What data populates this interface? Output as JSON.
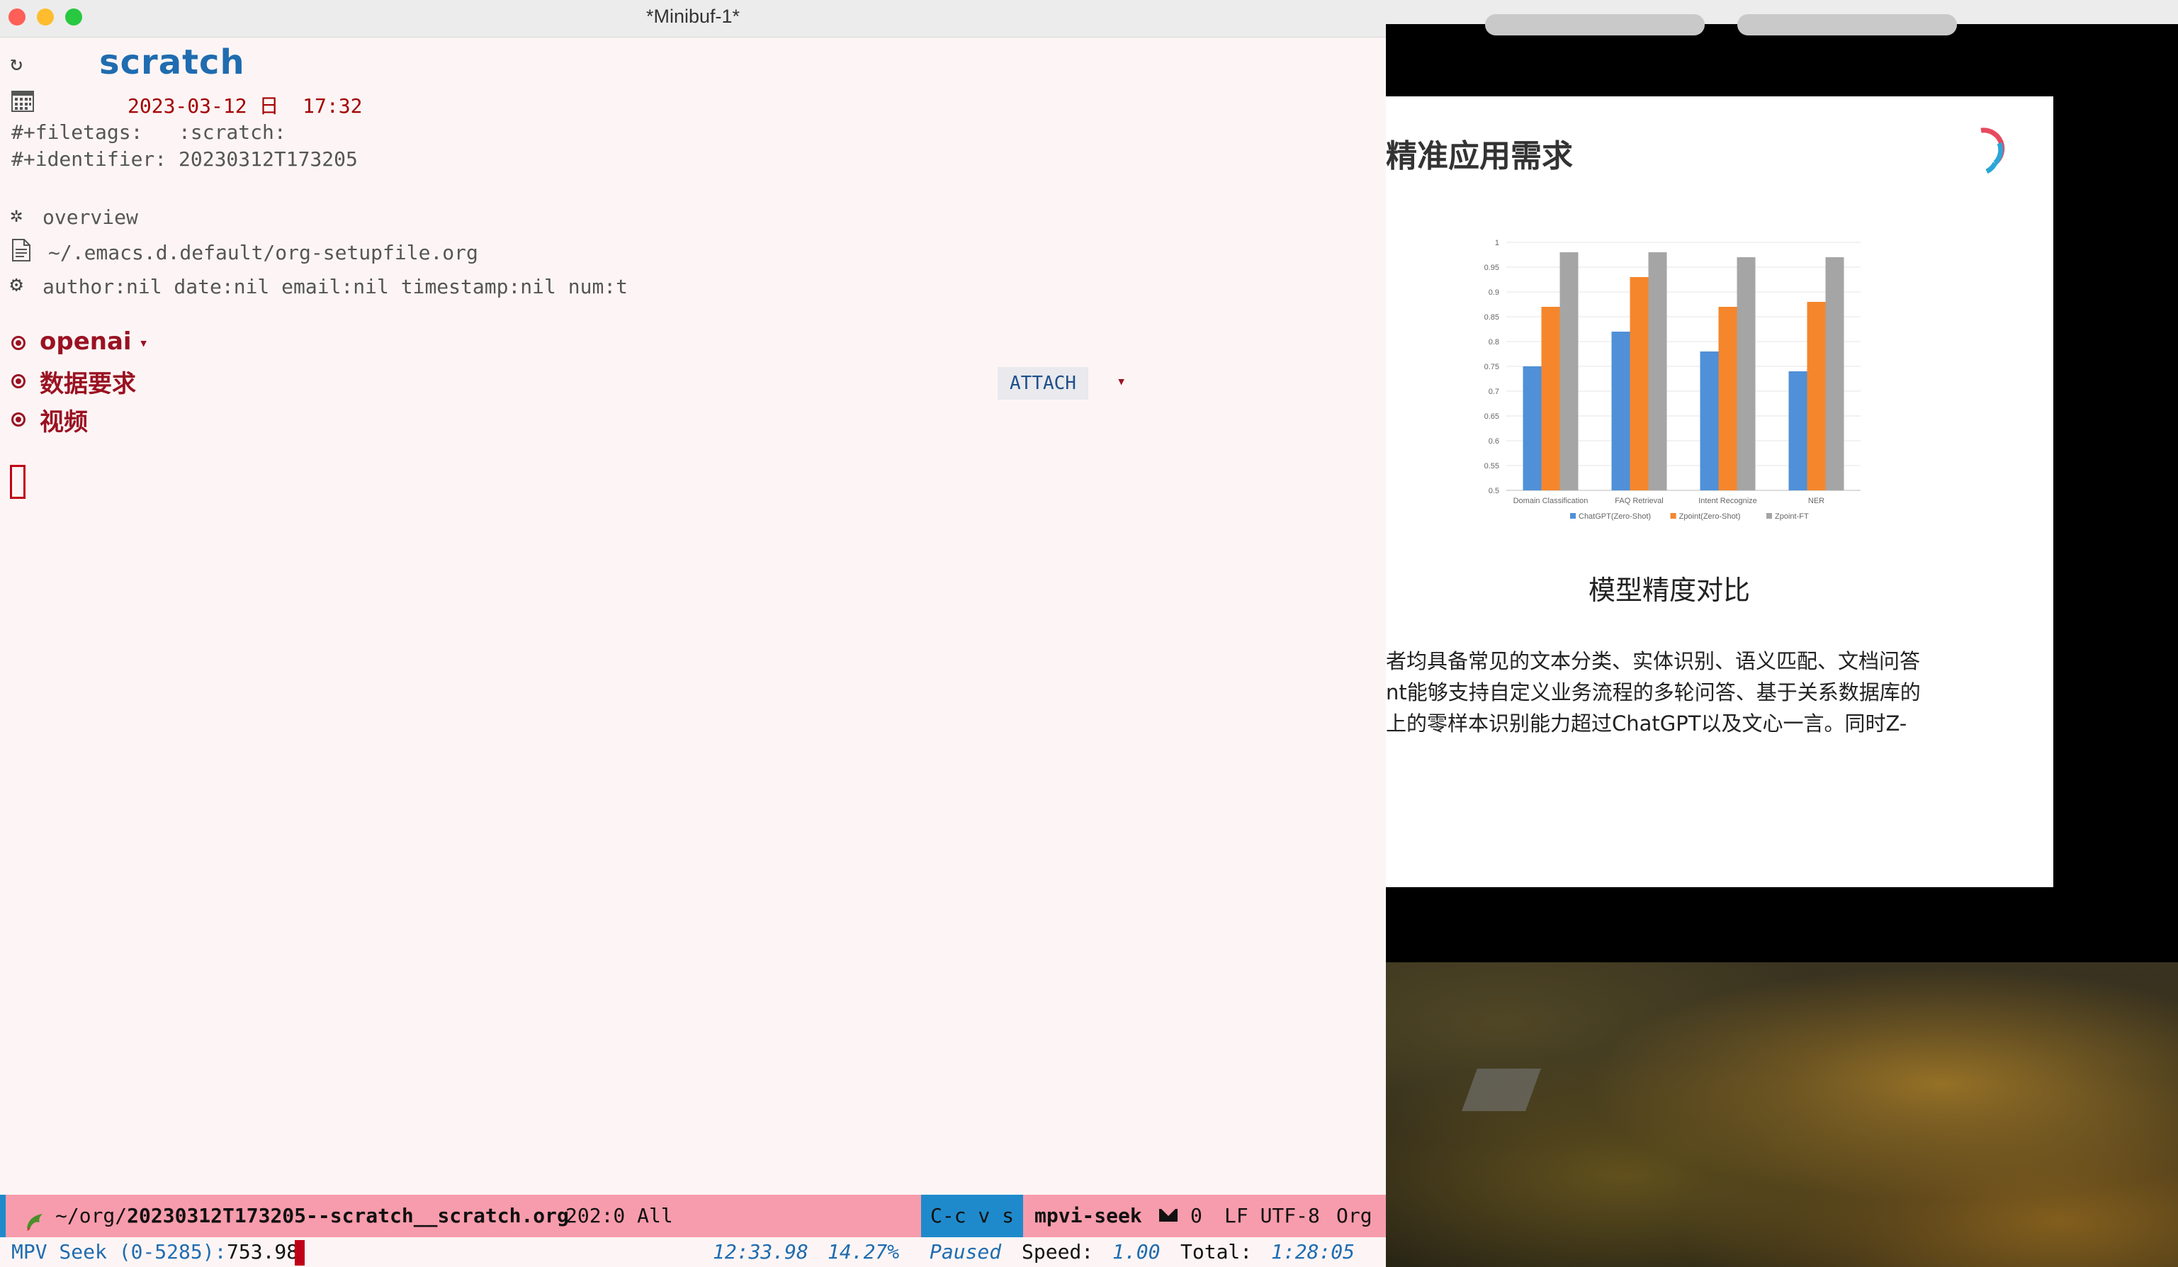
{
  "window": {
    "title": "*Minibuf-1*"
  },
  "buffer": {
    "title": "scratch",
    "date": "2023-03-12",
    "weekday": "日",
    "time": "17:32",
    "filetags_line": "#+filetags:   :scratch:",
    "identifier_line": "#+identifier: 20230312T173205",
    "overview_line": "overview",
    "setupfile_line": "~/.emacs.d.default/org-setupfile.org",
    "options_line": "author:nil date:nil email:nil timestamp:nil num:t",
    "headings": [
      {
        "text": "openai",
        "folded_marker": "▾"
      },
      {
        "text": "数据要求",
        "tag_button": "ATTACH",
        "folded_marker": "▾"
      },
      {
        "text": "视频"
      }
    ]
  },
  "modeline": {
    "path_prefix": "~/org/",
    "filename": "20230312T173205--scratch__scratch.org",
    "position": "202:0 All",
    "keys": "C-c v s",
    "mode": "mpvi-seek",
    "mail_count": "0",
    "encoding": "LF UTF-8",
    "major_mode": "Org"
  },
  "minibuffer": {
    "prompt": "MPV Seek (0-5285): ",
    "value": "753.98",
    "current_time": "12:33.98",
    "percent": "14.27%",
    "state": "Paused",
    "speed_label": "Speed:",
    "speed": "1.00",
    "total_label": "Total:",
    "total": "1:28:05"
  },
  "slide": {
    "title": "精准应用需求",
    "caption": "模型精度对比",
    "lines": [
      "者均具备常见的文本分类、实体识别、语义匹配、文档问答",
      "nt能够支持自定义业务流程的多轮问答、基于关系数据库的",
      "上的零样本识别能力超过ChatGPT以及文心一言。同时Z-"
    ]
  },
  "chart_data": {
    "type": "bar",
    "categories": [
      "Domain Classification",
      "FAQ Retrieval",
      "Intent Recognize",
      "NER"
    ],
    "series": [
      {
        "name": "ChatGPT(Zero-Shot)",
        "values": [
          0.75,
          0.82,
          0.78,
          0.74
        ],
        "color": "#4f90d8"
      },
      {
        "name": "Zpoint(Zero-Shot)",
        "values": [
          0.87,
          0.93,
          0.87,
          0.88
        ],
        "color": "#f5862c"
      },
      {
        "name": "Zpoint-FT",
        "values": [
          0.98,
          0.98,
          0.97,
          0.97
        ],
        "color": "#a5a5a5"
      }
    ],
    "yticks": [
      "0.5",
      "0.55",
      "0.6",
      "0.65",
      "0.7",
      "0.75",
      "0.8",
      "0.85",
      "0.9",
      "0.95",
      "1"
    ],
    "ylim": [
      0.5,
      1
    ],
    "grid": true,
    "legend": "bottom"
  },
  "colors": {
    "heading_blue": "#1f6cb0",
    "headline_red": "#9a1222",
    "modeline_pink": "#f79cac",
    "modeline_blue": "#1f8acb"
  }
}
